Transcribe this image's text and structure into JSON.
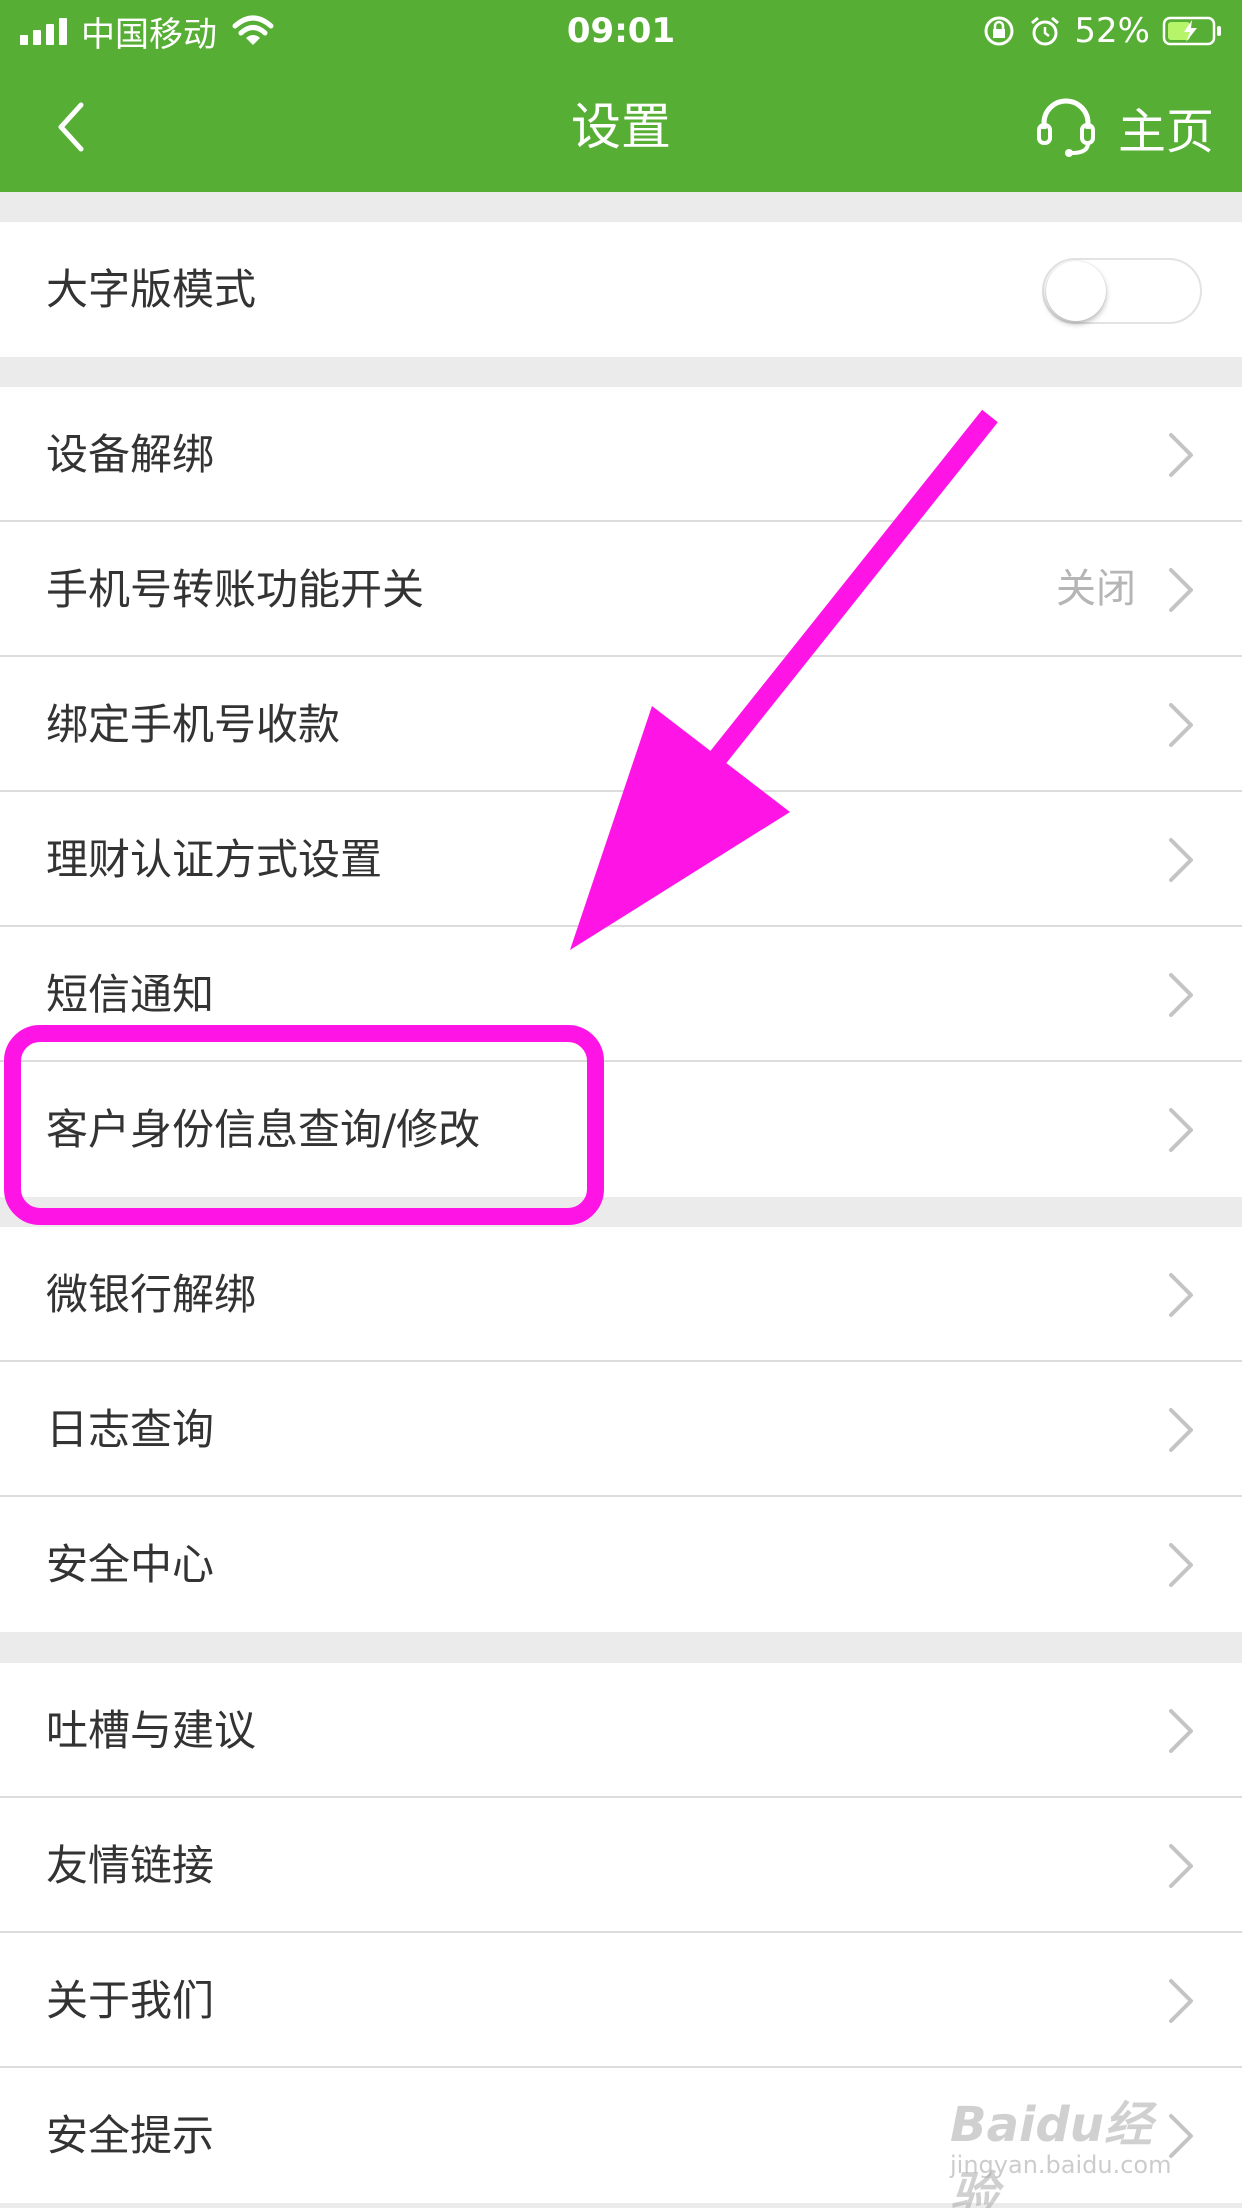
{
  "status_bar": {
    "carrier": "中国移动",
    "time": "09:01",
    "battery_percent": "52%",
    "icons": [
      "signal-icon",
      "wifi-icon",
      "orientation-lock-icon",
      "alarm-icon",
      "battery-charging-icon"
    ]
  },
  "nav": {
    "title": "设置",
    "home_label": "主页",
    "icons": [
      "back-chevron-icon",
      "headset-icon"
    ]
  },
  "sections": [
    {
      "rows": [
        {
          "label": "大字版模式",
          "control": "toggle",
          "toggle_on": false
        }
      ]
    },
    {
      "rows": [
        {
          "label": "设备解绑"
        },
        {
          "label": "手机号转账功能开关",
          "value": "关闭"
        },
        {
          "label": "绑定手机号收款"
        },
        {
          "label": "理财认证方式设置"
        },
        {
          "label": "短信通知"
        },
        {
          "label": "客户身份信息查询/修改"
        }
      ]
    },
    {
      "rows": [
        {
          "label": "微银行解绑"
        },
        {
          "label": "日志查询"
        },
        {
          "label": "安全中心"
        }
      ]
    },
    {
      "rows": [
        {
          "label": "吐槽与建议"
        },
        {
          "label": "友情链接"
        },
        {
          "label": "关于我们"
        },
        {
          "label": "安全提示"
        }
      ]
    }
  ],
  "watermark": {
    "text": "Baidu经验",
    "subtext": "jingyan.baidu.com"
  },
  "colors": {
    "header_green": "#57ae34",
    "annotation_magenta": "#ff14e6",
    "page_background": "#ebebeb",
    "row_text": "#333333",
    "secondary_text": "#b5b5b5"
  }
}
